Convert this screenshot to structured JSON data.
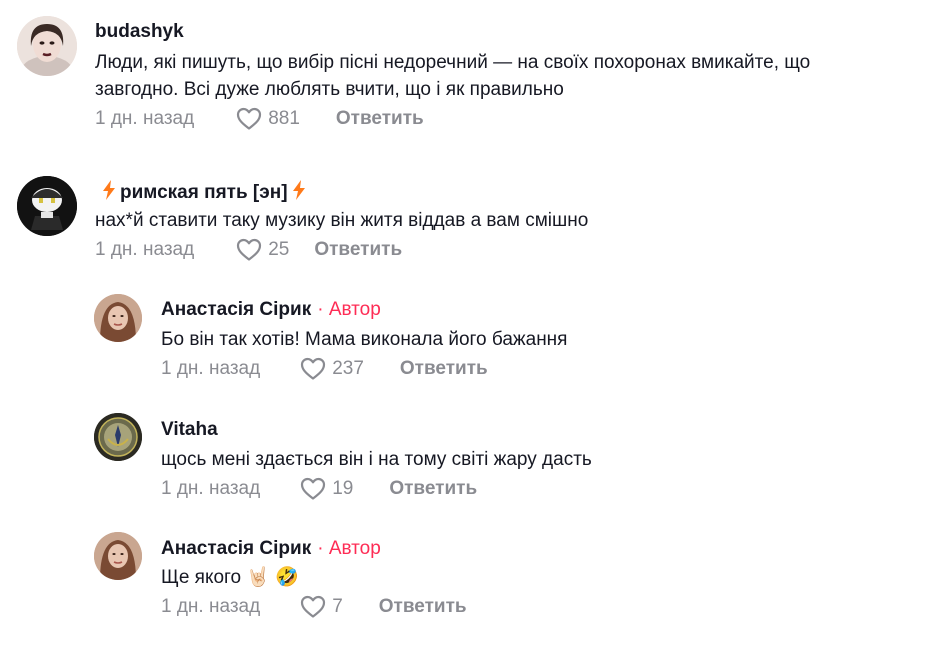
{
  "comments": [
    {
      "username": "budashyk",
      "text_line1": "Люди, які пишуть, що вибір пісні недоречний — на своїх похоронах вмикайте, що",
      "text_line2": "завгодно. Всі дуже люблять вчити, що і як правильно",
      "time": "1 дн. назад",
      "likes": "881",
      "reply_label": "Ответить"
    },
    {
      "username": "римская пять [эн]",
      "text_line1": "нах*й ставити таку музику він житя віддав а вам смішно",
      "time": "1 дн. назад",
      "likes": "25",
      "reply_label": "Ответить"
    }
  ],
  "replies": [
    {
      "username": "Анастасія Сірик",
      "author_tag": "· Автор",
      "text_line1": "Бо він так хотів! Мама виконала його бажання",
      "time": "1 дн. назад",
      "likes": "237",
      "reply_label": "Ответить"
    },
    {
      "username": "Vitaha",
      "text_line1": "щось мені здається він і на тому світі жару дасть",
      "time": "1 дн. назад",
      "likes": "19",
      "reply_label": "Ответить"
    },
    {
      "username": "Анастасія Сірик",
      "author_tag": "· Автор",
      "text_line1": "Ще якого 🤘🏻 🤣",
      "time": "1 дн. назад",
      "likes": "7",
      "reply_label": "Ответить"
    }
  ],
  "colors": {
    "author_accent": "#fe2c55",
    "meta_gray": "#8a8b91",
    "bolt_orange": "#ff7a1a"
  }
}
